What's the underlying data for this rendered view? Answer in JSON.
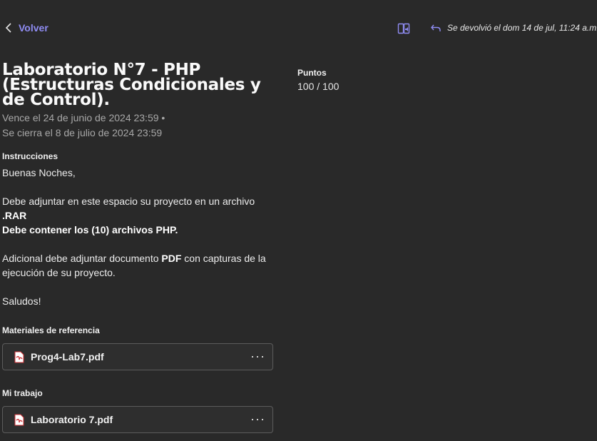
{
  "header": {
    "back_label": "Volver",
    "returned_text": "Se devolvió el dom 14 de jul, 11:24 a.m.",
    "icons": [
      "chevron-left-icon",
      "immersive-reader-icon",
      "return-arrow-icon"
    ]
  },
  "assignment": {
    "title": "Laboratorio N°7 - PHP (Estructuras Condicionales y de Control).",
    "due": "Vence el 24 de junio de 2024 23:59",
    "separator": "•",
    "closes": "Se cierra el 8 de julio de 2024 23:59"
  },
  "points": {
    "heading": "Puntos",
    "value": "100 / 100"
  },
  "instructions": {
    "heading": "Instrucciones",
    "greeting": "Buenas Noches,",
    "line1": "Debe adjuntar en este espacio su proyecto en un archivo",
    "line1_bold": ".RAR",
    "line2_bold": "Debe contener los (10) archivos PHP.",
    "line3_pre": "Adicional debe adjuntar documento ",
    "line3_bold": "PDF",
    "line3_post": " con capturas de la ejecución de su proyecto.",
    "closing": "Saludos!"
  },
  "reference_materials": {
    "heading": "Materiales de referencia",
    "files": [
      {
        "name": "Prog4-Lab7.pdf"
      }
    ]
  },
  "my_work": {
    "heading": "Mi trabajo",
    "files": [
      {
        "name": "Laboratorio 7.pdf"
      }
    ]
  },
  "more_label": "···",
  "colors": {
    "background": "#292929",
    "accent": "#8f8cf2",
    "pdf_red": "#d13438"
  }
}
